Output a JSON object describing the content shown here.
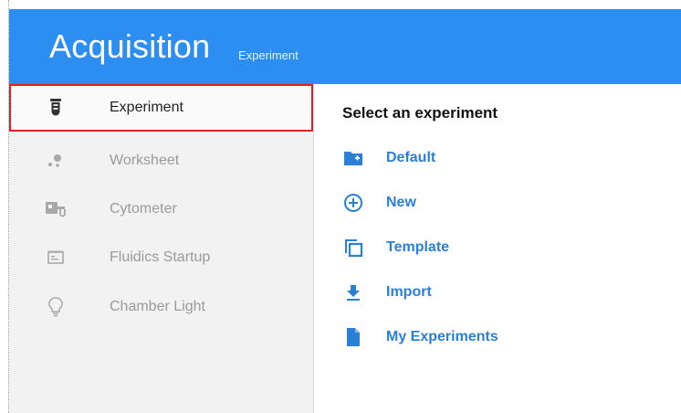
{
  "header": {
    "title": "Acquisition",
    "subtitle": "Experiment"
  },
  "sidebar": {
    "items": [
      {
        "label": "Experiment",
        "icon": "test-tube-icon",
        "active": true
      },
      {
        "label": "Worksheet",
        "icon": "scatter-dots-icon",
        "active": false
      },
      {
        "label": "Cytometer",
        "icon": "cytometer-icon",
        "active": false
      },
      {
        "label": "Fluidics Startup",
        "icon": "fluidics-icon",
        "active": false
      },
      {
        "label": "Chamber Light",
        "icon": "lightbulb-icon",
        "active": false
      }
    ]
  },
  "main": {
    "title": "Select an experiment",
    "actions": [
      {
        "label": "Default",
        "icon": "folder-plus-icon"
      },
      {
        "label": "New",
        "icon": "circle-plus-icon"
      },
      {
        "label": "Template",
        "icon": "copy-icon"
      },
      {
        "label": "Import",
        "icon": "download-icon"
      },
      {
        "label": "My Experiments",
        "icon": "document-icon"
      }
    ]
  },
  "colors": {
    "header_bg": "#2c8ef0",
    "accent_text": "#2a7fd6",
    "selection_outline": "#e02020",
    "sidebar_bg": "#f2f2f2"
  }
}
